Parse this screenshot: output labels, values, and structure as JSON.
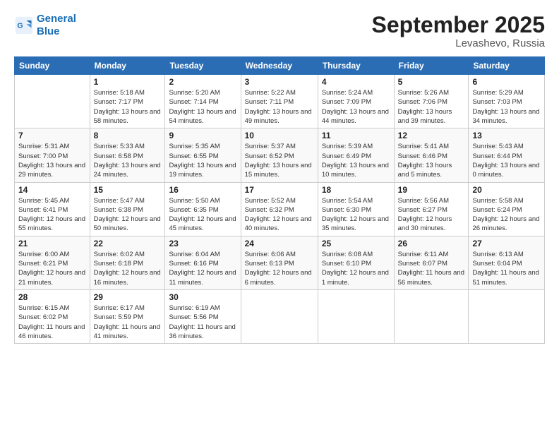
{
  "logo": {
    "line1": "General",
    "line2": "Blue"
  },
  "header": {
    "month": "September 2025",
    "location": "Levashevo, Russia"
  },
  "weekdays": [
    "Sunday",
    "Monday",
    "Tuesday",
    "Wednesday",
    "Thursday",
    "Friday",
    "Saturday"
  ],
  "weeks": [
    [
      {
        "day": "",
        "sunrise": "",
        "sunset": "",
        "daylight": ""
      },
      {
        "day": "1",
        "sunrise": "Sunrise: 5:18 AM",
        "sunset": "Sunset: 7:17 PM",
        "daylight": "Daylight: 13 hours and 58 minutes."
      },
      {
        "day": "2",
        "sunrise": "Sunrise: 5:20 AM",
        "sunset": "Sunset: 7:14 PM",
        "daylight": "Daylight: 13 hours and 54 minutes."
      },
      {
        "day": "3",
        "sunrise": "Sunrise: 5:22 AM",
        "sunset": "Sunset: 7:11 PM",
        "daylight": "Daylight: 13 hours and 49 minutes."
      },
      {
        "day": "4",
        "sunrise": "Sunrise: 5:24 AM",
        "sunset": "Sunset: 7:09 PM",
        "daylight": "Daylight: 13 hours and 44 minutes."
      },
      {
        "day": "5",
        "sunrise": "Sunrise: 5:26 AM",
        "sunset": "Sunset: 7:06 PM",
        "daylight": "Daylight: 13 hours and 39 minutes."
      },
      {
        "day": "6",
        "sunrise": "Sunrise: 5:29 AM",
        "sunset": "Sunset: 7:03 PM",
        "daylight": "Daylight: 13 hours and 34 minutes."
      }
    ],
    [
      {
        "day": "7",
        "sunrise": "Sunrise: 5:31 AM",
        "sunset": "Sunset: 7:00 PM",
        "daylight": "Daylight: 13 hours and 29 minutes."
      },
      {
        "day": "8",
        "sunrise": "Sunrise: 5:33 AM",
        "sunset": "Sunset: 6:58 PM",
        "daylight": "Daylight: 13 hours and 24 minutes."
      },
      {
        "day": "9",
        "sunrise": "Sunrise: 5:35 AM",
        "sunset": "Sunset: 6:55 PM",
        "daylight": "Daylight: 13 hours and 19 minutes."
      },
      {
        "day": "10",
        "sunrise": "Sunrise: 5:37 AM",
        "sunset": "Sunset: 6:52 PM",
        "daylight": "Daylight: 13 hours and 15 minutes."
      },
      {
        "day": "11",
        "sunrise": "Sunrise: 5:39 AM",
        "sunset": "Sunset: 6:49 PM",
        "daylight": "Daylight: 13 hours and 10 minutes."
      },
      {
        "day": "12",
        "sunrise": "Sunrise: 5:41 AM",
        "sunset": "Sunset: 6:46 PM",
        "daylight": "Daylight: 13 hours and 5 minutes."
      },
      {
        "day": "13",
        "sunrise": "Sunrise: 5:43 AM",
        "sunset": "Sunset: 6:44 PM",
        "daylight": "Daylight: 13 hours and 0 minutes."
      }
    ],
    [
      {
        "day": "14",
        "sunrise": "Sunrise: 5:45 AM",
        "sunset": "Sunset: 6:41 PM",
        "daylight": "Daylight: 12 hours and 55 minutes."
      },
      {
        "day": "15",
        "sunrise": "Sunrise: 5:47 AM",
        "sunset": "Sunset: 6:38 PM",
        "daylight": "Daylight: 12 hours and 50 minutes."
      },
      {
        "day": "16",
        "sunrise": "Sunrise: 5:50 AM",
        "sunset": "Sunset: 6:35 PM",
        "daylight": "Daylight: 12 hours and 45 minutes."
      },
      {
        "day": "17",
        "sunrise": "Sunrise: 5:52 AM",
        "sunset": "Sunset: 6:32 PM",
        "daylight": "Daylight: 12 hours and 40 minutes."
      },
      {
        "day": "18",
        "sunrise": "Sunrise: 5:54 AM",
        "sunset": "Sunset: 6:30 PM",
        "daylight": "Daylight: 12 hours and 35 minutes."
      },
      {
        "day": "19",
        "sunrise": "Sunrise: 5:56 AM",
        "sunset": "Sunset: 6:27 PM",
        "daylight": "Daylight: 12 hours and 30 minutes."
      },
      {
        "day": "20",
        "sunrise": "Sunrise: 5:58 AM",
        "sunset": "Sunset: 6:24 PM",
        "daylight": "Daylight: 12 hours and 26 minutes."
      }
    ],
    [
      {
        "day": "21",
        "sunrise": "Sunrise: 6:00 AM",
        "sunset": "Sunset: 6:21 PM",
        "daylight": "Daylight: 12 hours and 21 minutes."
      },
      {
        "day": "22",
        "sunrise": "Sunrise: 6:02 AM",
        "sunset": "Sunset: 6:18 PM",
        "daylight": "Daylight: 12 hours and 16 minutes."
      },
      {
        "day": "23",
        "sunrise": "Sunrise: 6:04 AM",
        "sunset": "Sunset: 6:16 PM",
        "daylight": "Daylight: 12 hours and 11 minutes."
      },
      {
        "day": "24",
        "sunrise": "Sunrise: 6:06 AM",
        "sunset": "Sunset: 6:13 PM",
        "daylight": "Daylight: 12 hours and 6 minutes."
      },
      {
        "day": "25",
        "sunrise": "Sunrise: 6:08 AM",
        "sunset": "Sunset: 6:10 PM",
        "daylight": "Daylight: 12 hours and 1 minute."
      },
      {
        "day": "26",
        "sunrise": "Sunrise: 6:11 AM",
        "sunset": "Sunset: 6:07 PM",
        "daylight": "Daylight: 11 hours and 56 minutes."
      },
      {
        "day": "27",
        "sunrise": "Sunrise: 6:13 AM",
        "sunset": "Sunset: 6:04 PM",
        "daylight": "Daylight: 11 hours and 51 minutes."
      }
    ],
    [
      {
        "day": "28",
        "sunrise": "Sunrise: 6:15 AM",
        "sunset": "Sunset: 6:02 PM",
        "daylight": "Daylight: 11 hours and 46 minutes."
      },
      {
        "day": "29",
        "sunrise": "Sunrise: 6:17 AM",
        "sunset": "Sunset: 5:59 PM",
        "daylight": "Daylight: 11 hours and 41 minutes."
      },
      {
        "day": "30",
        "sunrise": "Sunrise: 6:19 AM",
        "sunset": "Sunset: 5:56 PM",
        "daylight": "Daylight: 11 hours and 36 minutes."
      },
      {
        "day": "",
        "sunrise": "",
        "sunset": "",
        "daylight": ""
      },
      {
        "day": "",
        "sunrise": "",
        "sunset": "",
        "daylight": ""
      },
      {
        "day": "",
        "sunrise": "",
        "sunset": "",
        "daylight": ""
      },
      {
        "day": "",
        "sunrise": "",
        "sunset": "",
        "daylight": ""
      }
    ]
  ]
}
